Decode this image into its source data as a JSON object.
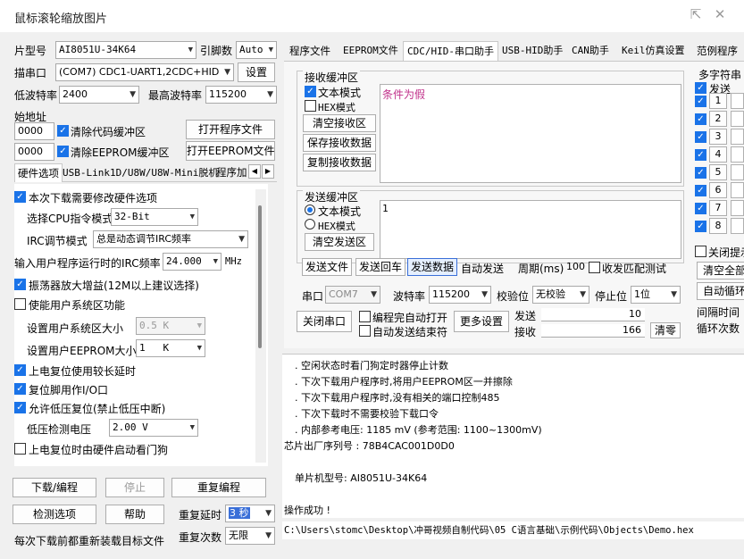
{
  "window": {
    "title": "鼠标滚轮缩放图片"
  },
  "left": {
    "chip_label": "片型号",
    "chip_value": "AI8051U-34K64",
    "pin_label": "引脚数",
    "pin_value": "Auto",
    "port_label": "描串口",
    "port_value": "(COM7) CDC1-UART1,2CDC+HID",
    "settings_btn": "设置",
    "min_baud_label": "低波特率",
    "min_baud_value": "2400",
    "max_baud_label": "最高波特率",
    "max_baud_value": "115200",
    "addr_label": "始地址",
    "addr1": "0000",
    "addr2": "0000",
    "clear_code": "清除代码缓冲区",
    "clear_eeprom": "清除EEPROM缓冲区",
    "open_prog": "打开程序文件",
    "open_eeprom": "打开EEPROM文件",
    "subtabs": [
      "硬件选项",
      "USB-Link1D/U8W/U8W-Mini脱机",
      "程序加"
    ],
    "opt_modify_hw": "本次下载需要修改硬件选项",
    "cpu_mode_label": "选择CPU指令模式",
    "cpu_mode_value": "32-Bit",
    "irc_mode_label": "IRC调节模式",
    "irc_mode_value": "总是动态调节IRC频率",
    "irc_freq_label": "输入用户程序运行时的IRC频率",
    "irc_freq_value": "24.000",
    "irc_unit": "MHz",
    "opt_osc_gain": "振荡器放大增益(12M以上建议选择)",
    "opt_sys_area": "使能用户系统区功能",
    "sys_area_size_label": "设置用户系统区大小",
    "sys_area_size_value": "0.5 K",
    "eeprom_size_label": "设置用户EEPROM大小",
    "eeprom_size_value": "1   K",
    "opt_long_reset": "上电复位使用较长延时",
    "opt_reset_io": "复位脚用作I/O口",
    "opt_lvd_reset": "允许低压复位(禁止低压中断)",
    "lvd_label": "低压检测电压",
    "lvd_value": "2.00 V",
    "opt_wdt": "上电复位时由硬件启动看门狗",
    "download_btn": "下载/编程",
    "stop_btn": "停止",
    "reprogram_btn": "重复编程",
    "check_btn": "检测选项",
    "help_btn": "帮助",
    "repeat_delay_label": "重复延时",
    "repeat_delay_value": "3 秒",
    "reload_label": "每次下载前都重新装载目标文件",
    "repeat_count_label": "重复次数",
    "repeat_count_value": "无限"
  },
  "tabs": [
    "程序文件",
    "EEPROM文件",
    "CDC/HID-串口助手",
    "USB-HID助手",
    "CAN助手",
    "Keil仿真设置",
    "范例程序"
  ],
  "serial": {
    "recv_title": "接收缓冲区",
    "recv_text_mode": "文本模式",
    "recv_hex_mode": "HEX模式",
    "clear_recv": "清空接收区",
    "save_recv": "保存接收数据",
    "copy_recv": "复制接收数据",
    "recv_content": "条件为假",
    "send_title": "发送缓冲区",
    "send_text_mode": "文本模式",
    "send_hex_mode": "HEX模式",
    "clear_send": "清空发送区",
    "send_content": "1",
    "send_file": "发送文件",
    "send_enter": "发送回车",
    "send_data": "发送数据",
    "auto_send": "自动发送",
    "period_label": "周期(ms)",
    "period_value": "100",
    "match_label": "收发匹配测试",
    "port_label": "串口",
    "port_value": "COM7",
    "baud_label": "波特率",
    "baud_value": "115200",
    "parity_label": "校验位",
    "parity_value": "无校验",
    "stop_label": "停止位",
    "stop_value": "1位",
    "close_port": "关闭串口",
    "auto_open": "编程完自动打开",
    "auto_send_end": "自动发送结束符",
    "more_settings": "更多设置",
    "sent_label": "发送",
    "sent_value": "10",
    "recv_label": "接收",
    "recv_value": "166",
    "clear_count": "清零"
  },
  "multi": {
    "title": "多字符串",
    "send_label": "发送",
    "rows": [
      "1",
      "2",
      "3",
      "4",
      "5",
      "6",
      "7",
      "8"
    ],
    "close_hint": "关闭提示",
    "clear_all": "清空全部",
    "auto_loop": "自动循环",
    "interval_label": "间隔时间",
    "loop_count_label": "循环次数"
  },
  "log": {
    "lines": [
      ". 空闲状态时看门狗定时器停止计数",
      ". 下次下载用户程序时,将用户EEPROM区一并擦除",
      ". 下次下载用户程序时,没有相关的端口控制485",
      ". 下次下载时不需要校验下载口令",
      ". 内部参考电压: 1185 mV (参考范围: 1100~1300mV)",
      "芯片出厂序列号 : 78B4CAC001D0D0",
      "",
      "单片机型号: AI8051U-34K64",
      "",
      "操作成功 !"
    ]
  },
  "status": {
    "path": "C:\\Users\\stomc\\Desktop\\冲哥视频自制代码\\05 C语言基础\\示例代码\\Objects\\Demo.hex"
  }
}
